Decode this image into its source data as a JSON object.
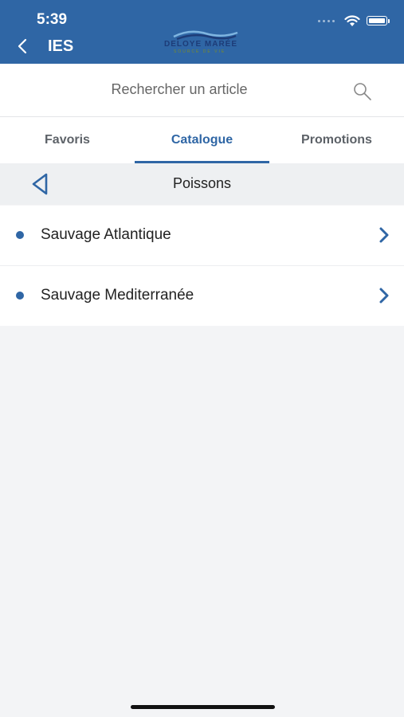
{
  "status_bar": {
    "time": "5:39"
  },
  "header": {
    "title": "IES",
    "logo_text": "DELOYE MARÉE",
    "logo_subtext": "SOURCE DE VIE"
  },
  "search": {
    "placeholder": "Rechercher un article"
  },
  "tabs": [
    {
      "label": "Favoris",
      "active": false
    },
    {
      "label": "Catalogue",
      "active": true
    },
    {
      "label": "Promotions",
      "active": false
    }
  ],
  "breadcrumb": {
    "title": "Poissons"
  },
  "list": {
    "items": [
      {
        "label": "Sauvage Atlantique"
      },
      {
        "label": "Sauvage Mediterranée"
      }
    ]
  },
  "colors": {
    "primary": "#2f66a5",
    "background": "#f3f4f6"
  }
}
